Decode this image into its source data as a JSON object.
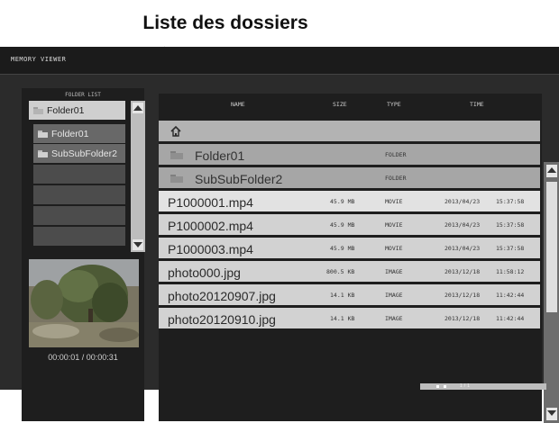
{
  "caption": "Liste des dossiers",
  "app_title": "MEMORY VIEWER",
  "folder_list": {
    "label": "FOLDER LIST",
    "items": [
      {
        "label": "Folder01",
        "icon": "folder-icon"
      },
      {
        "label": "Folder01",
        "icon": "folder-icon"
      },
      {
        "label": "SubSubFolder2",
        "icon": "folder-icon"
      }
    ]
  },
  "preview": {
    "time": "00:00:01 / 00:00:31"
  },
  "file_list": {
    "headers": {
      "name": "NAME",
      "size": "SIZE",
      "type": "TYPE",
      "time": "TIME"
    },
    "parent_icon": "home-icon",
    "folders": [
      {
        "name": "Folder01",
        "type": "FOLDER"
      },
      {
        "name": "SubSubFolder2",
        "type": "FOLDER"
      }
    ],
    "files": [
      {
        "name": "P1000001.mp4",
        "size": "45.9 MB",
        "type": "MOVIE",
        "date": "2013/04/23",
        "time": "15:37:58"
      },
      {
        "name": "P1000002.mp4",
        "size": "45.9 MB",
        "type": "MOVIE",
        "date": "2013/04/23",
        "time": "15:37:58"
      },
      {
        "name": "P1000003.mp4",
        "size": "45.9 MB",
        "type": "MOVIE",
        "date": "2013/04/23",
        "time": "15:37:58"
      },
      {
        "name": "photo000.jpg",
        "size": "800.5 KB",
        "type": "IMAGE",
        "date": "2013/12/18",
        "time": "11:58:12"
      },
      {
        "name": "photo20120907.jpg",
        "size": "14.1 KB",
        "type": "IMAGE",
        "date": "2013/12/18",
        "time": "11:42:44"
      },
      {
        "name": "photo20120910.jpg",
        "size": "14.1 KB",
        "type": "IMAGE",
        "date": "2013/12/18",
        "time": "11:42:44"
      }
    ]
  },
  "status_strip": {
    "page": "1 / 1"
  },
  "colors": {
    "screen_bg": "#2b2b2b",
    "panel_bg": "#1e1e1e",
    "row_light": "#d2d2d2",
    "row_selected": "#e2e2e2"
  }
}
